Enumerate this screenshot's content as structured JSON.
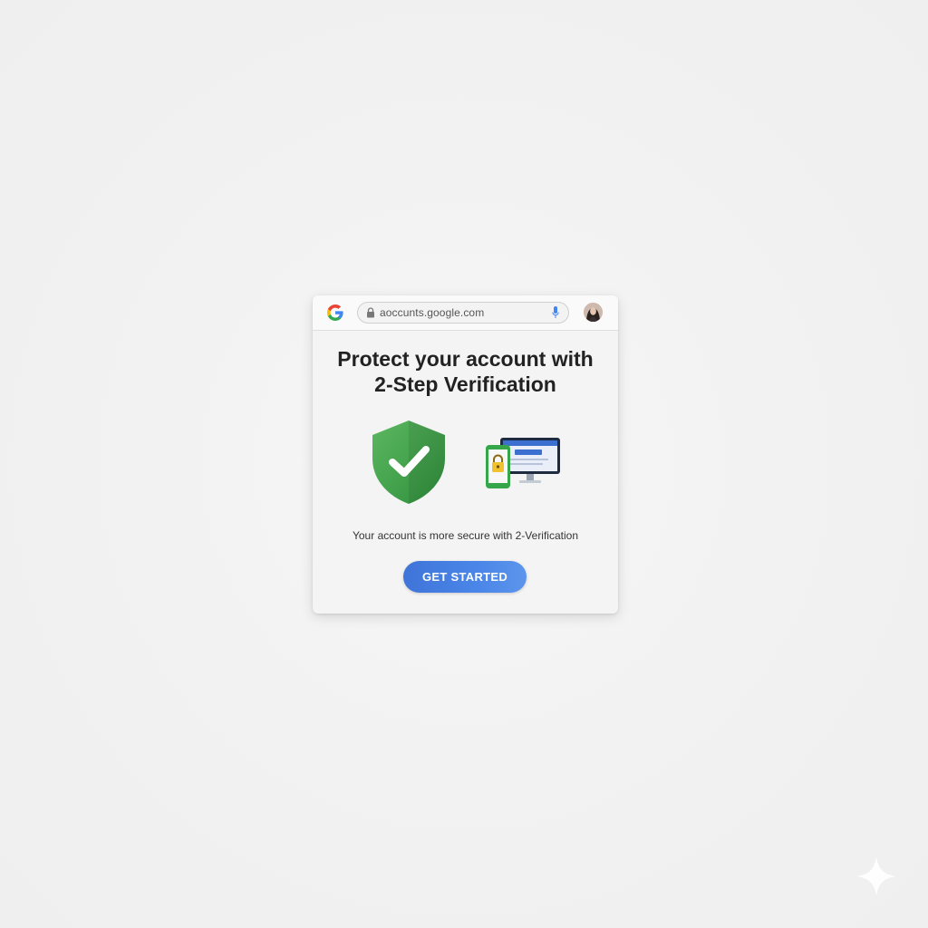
{
  "browser": {
    "url": "aoccunts.google.com"
  },
  "card": {
    "title_line1": "Protect your account with",
    "title_line2": "2-Step Verification",
    "description": "Your account is more secure with 2-Verification",
    "cta_label": "GET STARTED"
  },
  "icons": {
    "logo": "google-g-icon",
    "lock": "lock-icon",
    "mic": "mic-icon",
    "avatar": "avatar",
    "shield": "shield-check-icon",
    "devices": "phone-monitor-lock-icon",
    "sparkle": "sparkle-icon"
  },
  "colors": {
    "accent": "#4a86e8",
    "shield_green": "#3fa14a",
    "background": "#f2f2f2"
  }
}
